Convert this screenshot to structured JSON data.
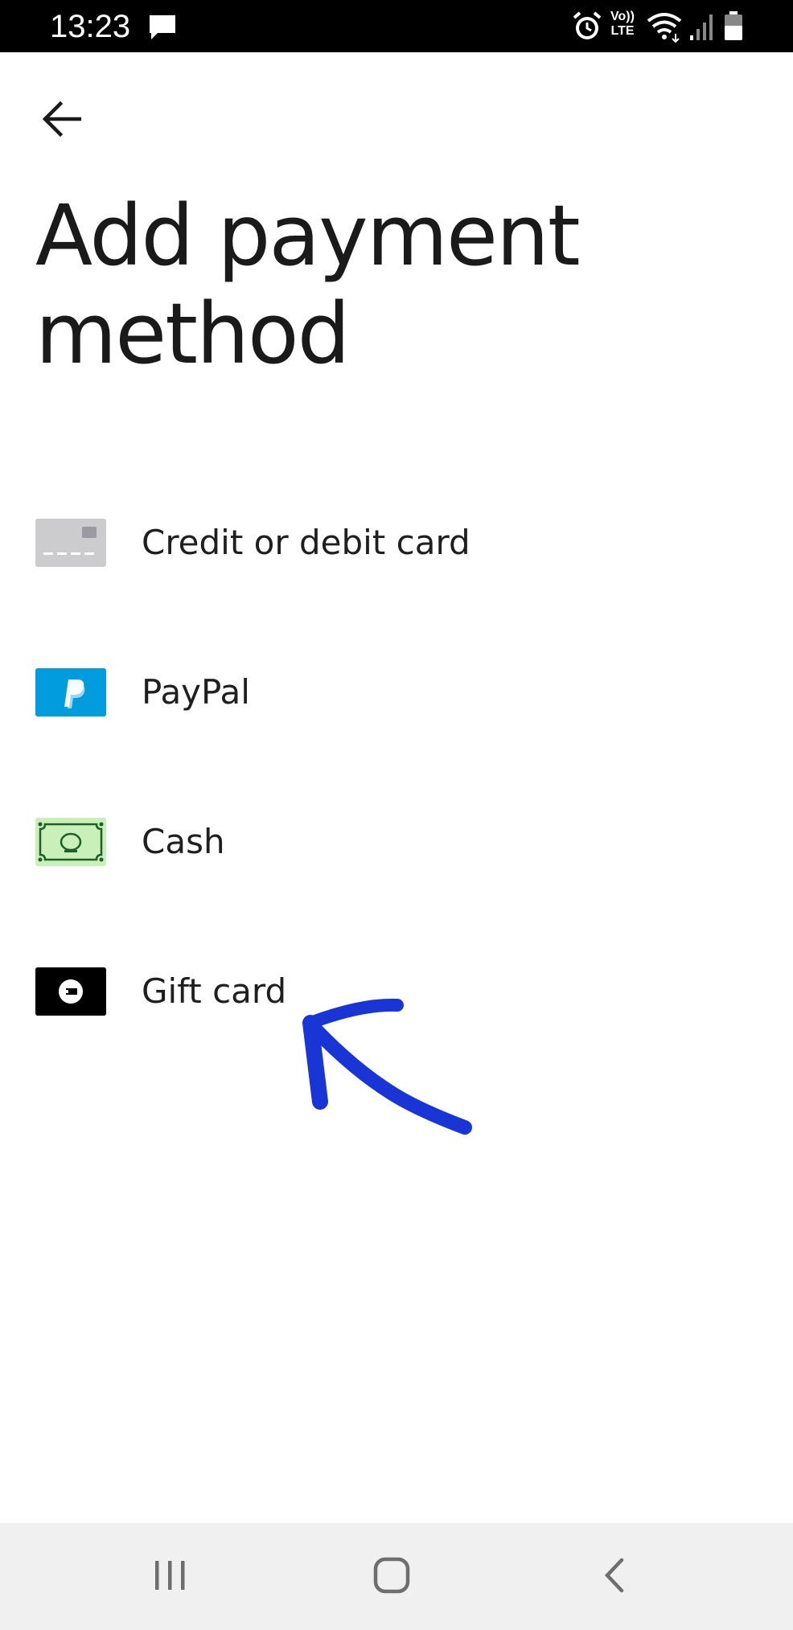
{
  "status_bar": {
    "time": "13:23",
    "network_label": "Vo)) LTE",
    "icons": [
      "message-icon",
      "alarm-icon",
      "volte-icon",
      "wifi-icon",
      "signal-icon",
      "battery-icon"
    ]
  },
  "header": {
    "back_icon": "arrow-left-icon",
    "title": "Add payment method"
  },
  "payment_methods": [
    {
      "label": "Credit or debit card",
      "icon": "credit-card-icon",
      "icon_color": "#cccccf"
    },
    {
      "label": "PayPal",
      "icon": "paypal-icon",
      "icon_color": "#009cde"
    },
    {
      "label": "Cash",
      "icon": "cash-icon",
      "icon_color": "#c8f0b8"
    },
    {
      "label": "Gift card",
      "icon": "gift-card-icon",
      "icon_color": "#000000"
    }
  ],
  "annotation": {
    "type": "hand-drawn-arrow",
    "color": "#1a35d6",
    "points_to": "Gift card"
  },
  "nav_bar": {
    "buttons": [
      "recents-icon",
      "home-icon",
      "back-icon"
    ]
  }
}
